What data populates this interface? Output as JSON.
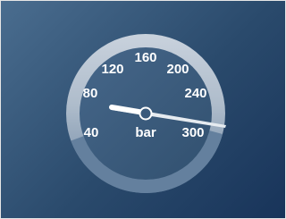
{
  "gauge": {
    "unit": "bar",
    "value": 300,
    "min": 0,
    "max": 300,
    "ticks": [
      "40",
      "80",
      "120",
      "160",
      "200",
      "240",
      "300"
    ],
    "colors": {
      "background_light": "#4a6d8f",
      "background_dark": "#18345a",
      "ring_light": "#c5cfdb",
      "ring_dark": "#5d7794",
      "face": "#3e5d7e",
      "label": "#ffffff",
      "needle": "#e4e9ee"
    }
  }
}
